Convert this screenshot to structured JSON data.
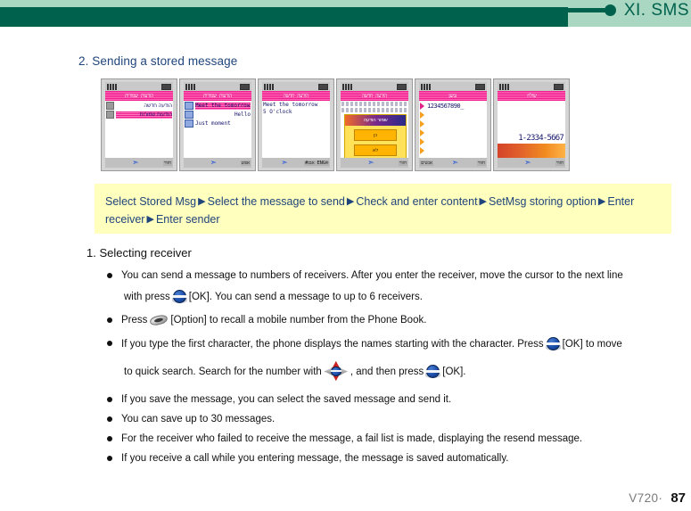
{
  "header": {
    "title": "XI. SMS",
    "bar_color": "#00624d",
    "mint_color": "#a9d7c2"
  },
  "section": {
    "title": "2. Sending a stored message"
  },
  "phones": [
    {
      "name": "stored-msg-list",
      "title": "הודעות שמורות",
      "rows": [
        {
          "num": "1",
          "text": "הודעה חדשה",
          "highlight": false
        },
        {
          "num": "2",
          "text": "הודעות שמורות",
          "highlight": true
        }
      ],
      "softkey_left": "",
      "softkey_right": "חזור"
    },
    {
      "name": "message-select-list",
      "title": "הודעות שמורות",
      "items": [
        {
          "text": "Meet the tomorrow",
          "highlight": true
        },
        {
          "text": "Hello",
          "highlight": false
        },
        {
          "text": "Just moment",
          "highlight": false
        }
      ],
      "softkey_left": "",
      "softkey_right": "אפש"
    },
    {
      "name": "message-content",
      "title": "הודעה חדשה",
      "content_lines": [
        "Meet the tomorrow",
        "5 O'clock"
      ],
      "softkey_left": "",
      "softkey_right": "#אבג ENG®"
    },
    {
      "name": "setmsg-storing-option",
      "title": "הודעה חדשה",
      "popup_title": "שמור הודעה",
      "popup_buttons": [
        "כן",
        "לא"
      ],
      "softkey_left": "",
      "softkey_right": "חזור"
    },
    {
      "name": "enter-receiver",
      "title": "נמען",
      "receiver_value": "1234567890_",
      "receiver_slots": 6,
      "softkey_left": "אנשים",
      "softkey_right": "חזור"
    },
    {
      "name": "enter-sender",
      "title": "שולח",
      "sender_value": "1-2334-5667",
      "softkey_left": "",
      "softkey_right": "חזור"
    }
  ],
  "flow": {
    "steps": [
      "Select Stored Msg",
      "Select the message to send",
      "Check and enter content",
      "SetMsg storing option",
      "Enter receiver",
      "Enter sender"
    ],
    "separator": "▶",
    "background": "#ffffbe",
    "text_color": "#20457c"
  },
  "body": {
    "subhead": "1. Selecting receiver",
    "bullets": [
      {
        "line1_a": "You can send a message to numbers of receivers. After you enter the receiver, move the cursor to the next line",
        "line2_a": "with press",
        "icon1": "ok-key-icon",
        "line2_b": "[OK]. You can send a message to up to 6 receivers."
      },
      {
        "line1_a": "Press",
        "icon1": "soft-key-icon",
        "line1_b": "[Option] to recall a mobile number from the Phone Book."
      },
      {
        "line1_a": "If you type the first character, the phone displays the names starting with the character. Press",
        "icon1": "ok-key-icon",
        "line1_b": "[OK] to move",
        "line2_a": "to quick search. Search for the number with",
        "icon2": "nav-key-icon",
        "line2_b": ", and then press",
        "icon3": "ok-key-icon",
        "line2_c": "[OK]."
      },
      {
        "line1_a": "If you save the message, you can select the saved message and send it."
      },
      {
        "line1_a": "You can save up to 30 messages."
      },
      {
        "line1_a": "For the receiver who failed to receive the message, a fail list is made, displaying the resend message."
      },
      {
        "line1_a": "If you receive a call while you entering message, the message is saved automatically."
      }
    ]
  },
  "footer": {
    "model": "V720·",
    "page": "87"
  }
}
